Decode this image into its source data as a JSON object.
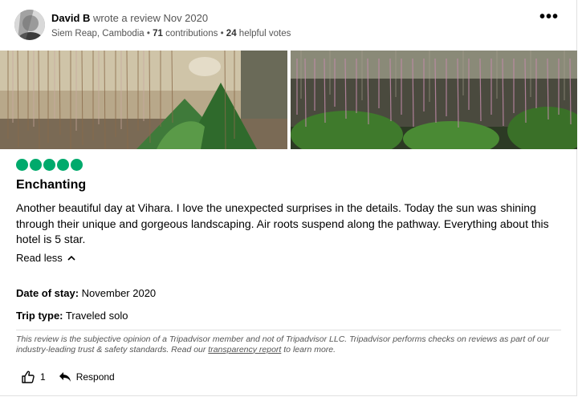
{
  "review": {
    "author": "David B",
    "action": "wrote a review Nov 2020",
    "location": "Siem Reap, Cambodia",
    "separator": "•",
    "contributions_count": "71",
    "contributions_label": "contributions",
    "helpful_count": "24",
    "helpful_label": "helpful votes",
    "rating_bubbles": 5,
    "title": "Enchanting",
    "text": "Another beautiful day at Vihara. I love the unexpected surprises in the details. Today the sun was shining through their unique and gorgeous landscaping. Air roots suspend along the pathway. Everything about this hotel is 5 star.",
    "read_less_label": "Read less",
    "date_of_stay_label": "Date of stay:",
    "date_of_stay_value": "November 2020",
    "trip_type_label": "Trip type:",
    "trip_type_value": "Traveled solo",
    "disclaimer_before": "This review is the subjective opinion of a Tripadvisor member and not of Tripadvisor LLC. Tripadvisor performs checks on reviews as part of our industry-leading trust & safety standards. Read our",
    "disclaimer_link": "transparency report",
    "disclaimer_after": "to learn more.",
    "helpful_votes": "1",
    "respond_label": "Respond"
  },
  "icons": {
    "menu": "more-horizontal-icon",
    "read_less": "chevron-up-icon",
    "helpful": "thumbs-up-icon",
    "respond": "reply-arrow-icon"
  },
  "colors": {
    "bubble": "#00aa6c",
    "text": "#000000",
    "muted": "#555555"
  }
}
